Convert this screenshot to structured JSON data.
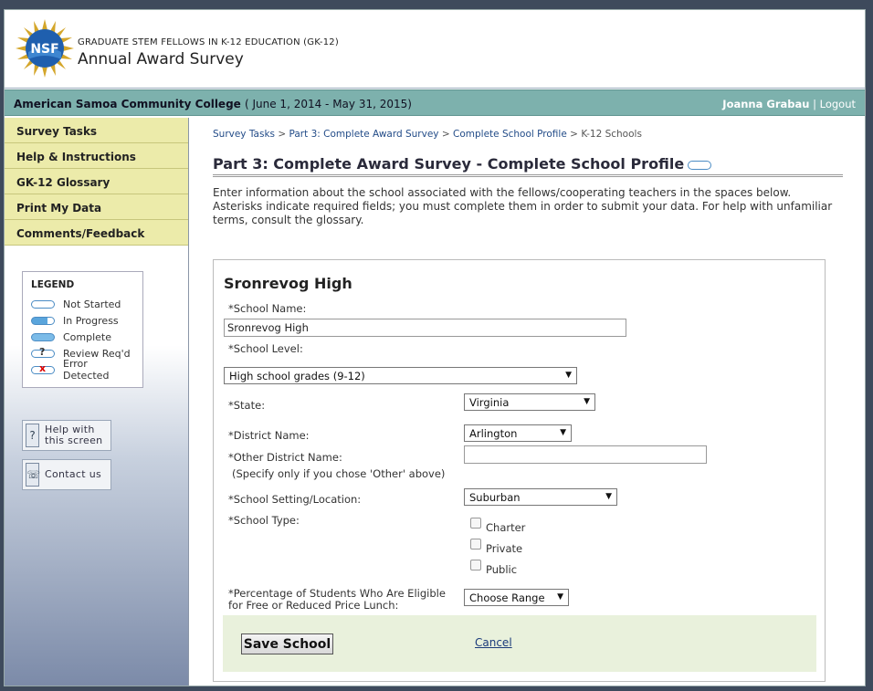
{
  "header": {
    "logo_text": "NSF",
    "program": "GRADUATE STEM FELLOWS IN K-12 EDUCATION (GK-12)",
    "title": "Annual Award Survey"
  },
  "institution": {
    "name": "American Samoa Community College",
    "period": "( June 1, 2014 - May 31, 2015)",
    "user": "Joanna Grabau",
    "separator": "|",
    "logout": "Logout"
  },
  "sidebar": {
    "items": [
      {
        "label": "Survey Tasks"
      },
      {
        "label": "Help & Instructions"
      },
      {
        "label": "GK-12 Glossary"
      },
      {
        "label": "Print My Data"
      },
      {
        "label": "Comments/Feedback"
      }
    ],
    "legend": {
      "title": "LEGEND",
      "items": [
        {
          "label": "Not Started"
        },
        {
          "label": "In Progress"
        },
        {
          "label": "Complete"
        },
        {
          "label": "Review Req'd",
          "mark": "?"
        },
        {
          "label": "Error Detected",
          "mark": "x"
        }
      ]
    },
    "help_button": {
      "line1": "Help with",
      "line2": "this screen",
      "icon": "?"
    },
    "contact_button": {
      "label": "Contact us",
      "icon": "☏"
    }
  },
  "breadcrumb": {
    "items": [
      "Survey Tasks",
      "Part 3: Complete Award Survey",
      "Complete School Profile",
      "K-12 Schools"
    ],
    "separator": ">"
  },
  "page": {
    "title": "Part 3: Complete Award Survey - Complete School Profile",
    "intro": "Enter information about the school associated with the fellows/cooperating teachers in the spaces below. Asterisks indicate required fields; you must complete them in order to submit your data. For help with unfamiliar terms, consult the glossary."
  },
  "form": {
    "heading": "Sronrevog High",
    "school_name_label": "*School Name:",
    "school_name_value": "Sronrevog High",
    "school_level_label": "*School Level:",
    "school_level_value": "High school grades (9-12)",
    "state_label": "*State:",
    "state_value": "Virginia",
    "district_label": "*District Name:",
    "district_value": "Arlington",
    "other_district_label": "*Other District Name:",
    "other_district_note": "(Specify only if you chose 'Other' above)",
    "other_district_value": "",
    "setting_label": "*School Setting/Location:",
    "setting_value": "Suburban",
    "type_label": "*School Type:",
    "type_options": [
      "Charter",
      "Private",
      "Public"
    ],
    "lunch_label_1": "*Percentage of Students Who Are Eligible",
    "lunch_label_2": "for Free or Reduced Price Lunch:",
    "lunch_value": "Choose Range",
    "save_label": "Save School",
    "cancel_label": "Cancel"
  },
  "colors": {
    "accent_bar": "#7db1ad",
    "nav_bg": "#ecebaa",
    "action_bg": "#e9f1dc"
  }
}
